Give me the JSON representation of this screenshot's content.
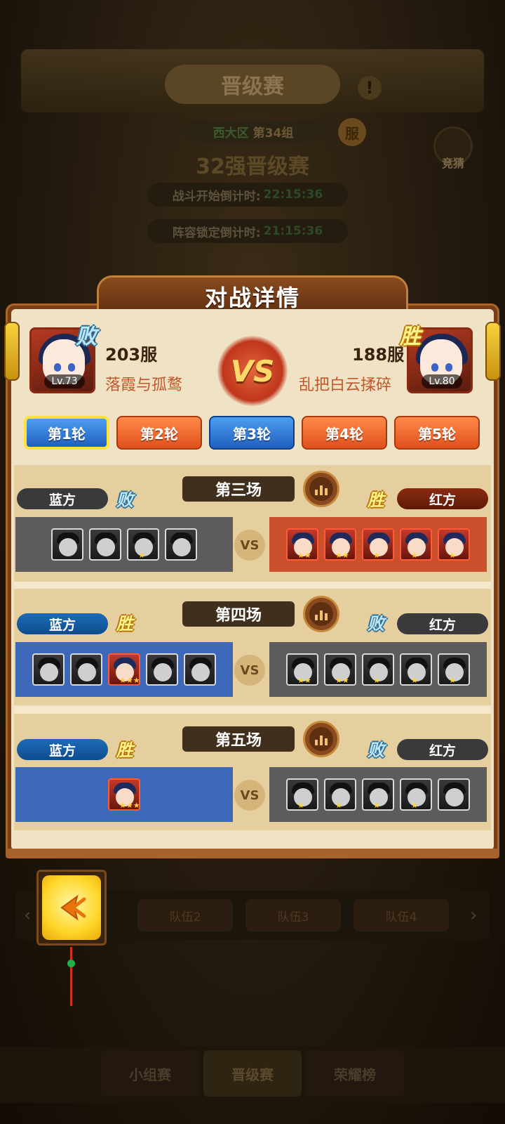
{
  "background": {
    "title": "晋级赛",
    "info_badge": "!",
    "region": "西大区",
    "group": "第34组",
    "fu_badge": "服",
    "bet_label": "竞猜",
    "stage": "32强晋级赛",
    "battle_countdown_label": "战斗开始倒计时:",
    "battle_countdown_time": "22:15:36",
    "lock_countdown_label": "阵容锁定倒计时:",
    "lock_countdown_time": "21:15:36",
    "team_tabs": [
      "队伍2",
      "队伍3",
      "队伍4"
    ],
    "bottom_tabs": [
      "小组赛",
      "晋级赛",
      "荣耀榜"
    ]
  },
  "modal": {
    "title": "对战详情",
    "vs_label": "VS",
    "left_player": {
      "server": "203服",
      "name": "落霞与孤鹜",
      "level": "Lv.73",
      "result": "败"
    },
    "right_player": {
      "server": "188服",
      "name": "乱把白云揉碎",
      "level": "Lv.80",
      "result": "胜"
    },
    "rounds": [
      "第1轮",
      "第2轮",
      "第3轮",
      "第4轮",
      "第5轮"
    ],
    "active_round": 0,
    "matches": [
      {
        "title": "第三场",
        "blue_label": "蓝方",
        "red_label": "红方",
        "blue_result": "败",
        "red_result": "胜",
        "vs": "VS"
      },
      {
        "title": "第四场",
        "blue_label": "蓝方",
        "red_label": "红方",
        "blue_result": "胜",
        "red_result": "败",
        "vs": "VS"
      },
      {
        "title": "第五场",
        "blue_label": "蓝方",
        "red_label": "红方",
        "blue_result": "胜",
        "red_result": "败",
        "vs": "VS"
      }
    ]
  },
  "colors": {
    "win_gold": "#fff38a",
    "lose_blue": "#bfe6f5",
    "blue_team": "#3d68ba",
    "red_team": "#c9502a",
    "defeated_gray": "#5c5c5c"
  },
  "icons": {
    "back": "back-arrow-icon",
    "replay": "battle-replay-icon",
    "bet": "bet-coin-icon"
  }
}
